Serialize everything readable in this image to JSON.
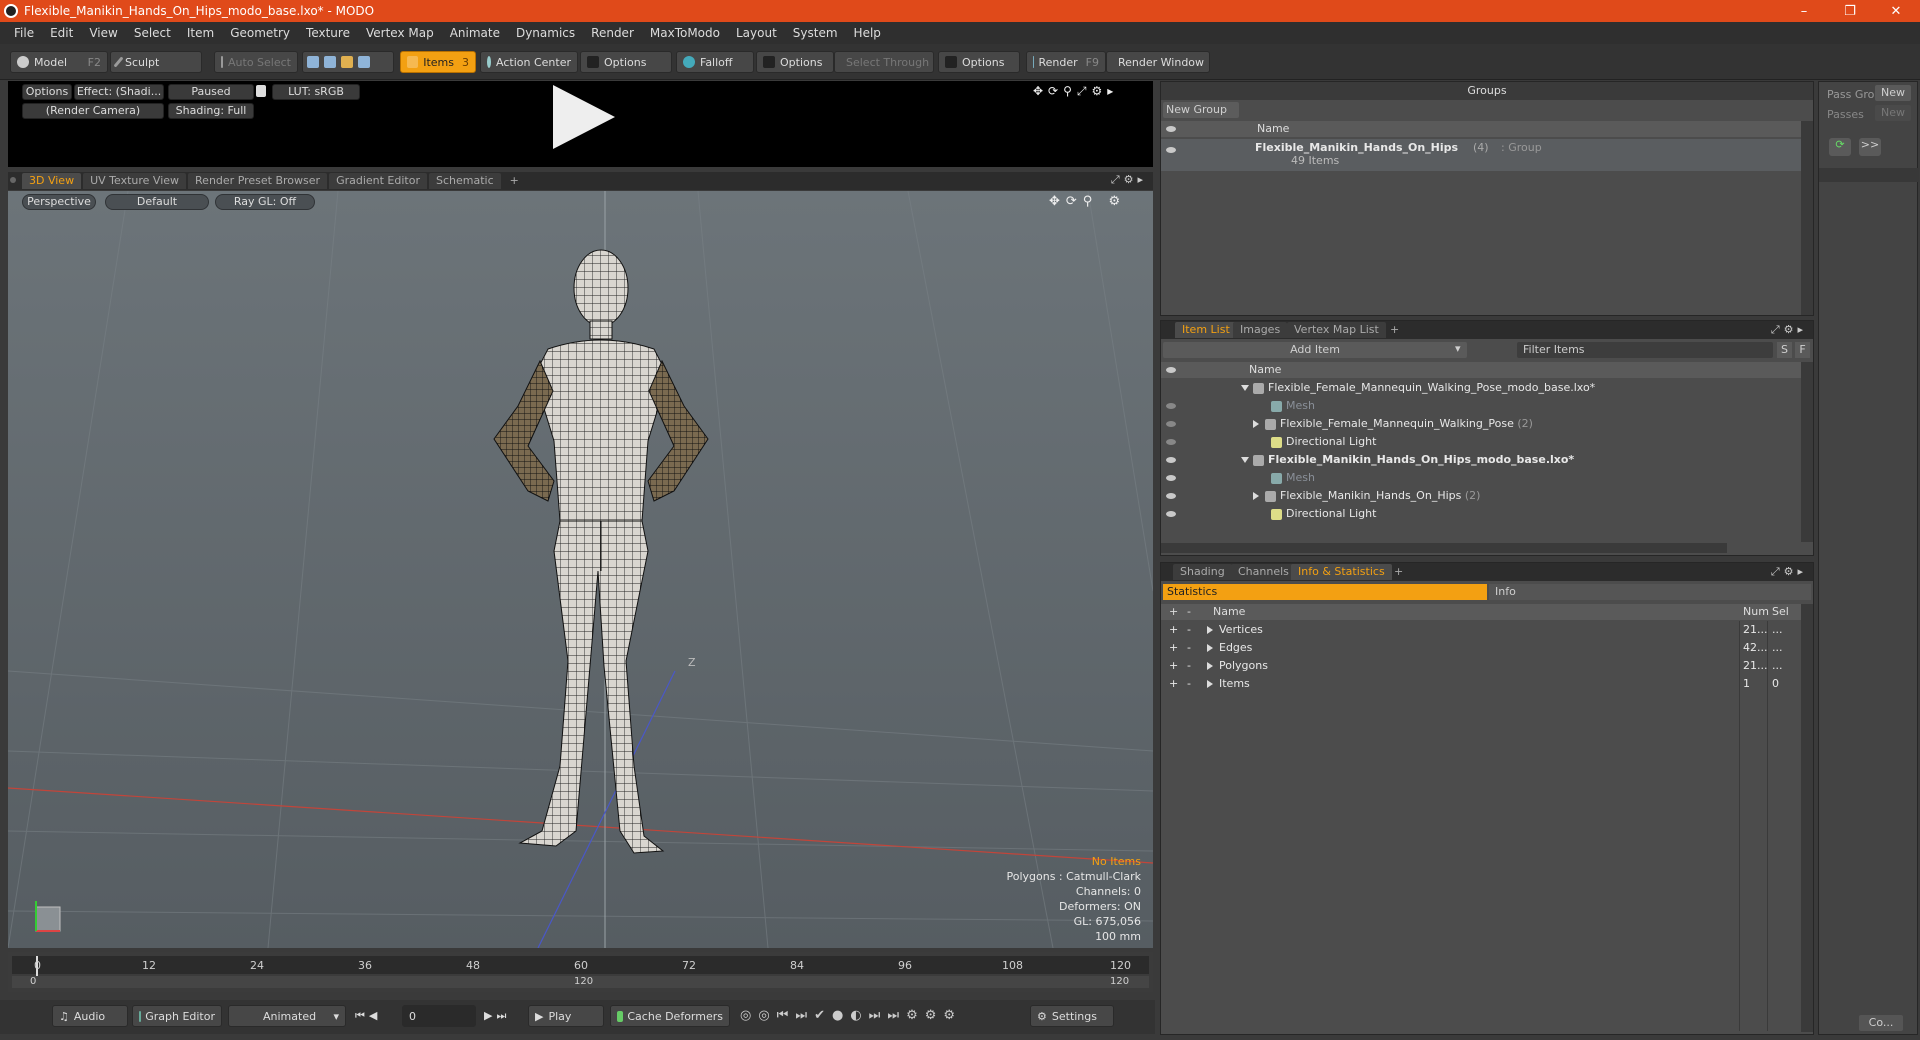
{
  "window": {
    "title": "Flexible_Manikin_Hands_On_Hips_modo_base.lxo* - MODO",
    "min": "–",
    "max": "❐",
    "close": "✕"
  },
  "menu": [
    "File",
    "Edit",
    "View",
    "Select",
    "Item",
    "Geometry",
    "Texture",
    "Vertex Map",
    "Animate",
    "Dynamics",
    "Render",
    "MaxToModo",
    "Layout",
    "System",
    "Help"
  ],
  "toolbar": {
    "model": "Model",
    "model_key": "F2",
    "sculpt": "Sculpt",
    "auto_select": "Auto Select",
    "items": "Items",
    "items_key": "3",
    "action_center": "Action Center",
    "options1": "Options",
    "falloff": "Falloff",
    "options2": "Options",
    "select_through": "Select Through",
    "options3": "Options",
    "render": "Render",
    "render_key": "F9",
    "render_window": "Render Window"
  },
  "preview": {
    "options": "Options",
    "effect": "Effect: (Shadi...",
    "paused": "Paused",
    "lut": "LUT: sRGB",
    "camera": "(Render Camera)",
    "shading": "Shading: Full"
  },
  "viewtabs": [
    "3D View",
    "UV Texture View",
    "Render Preset Browser",
    "Gradient Editor",
    "Schematic",
    "+"
  ],
  "viewport": {
    "perspective": "Perspective",
    "default": "Default",
    "raygl": "Ray GL: Off",
    "axis_z": "Z"
  },
  "stats": {
    "no_items": "No Items",
    "polygons": "Polygons : Catmull-Clark",
    "channels": "Channels: 0",
    "deformers": "Deformers: ON",
    "gl": "GL: 675,056",
    "size": "100 mm"
  },
  "timeline": {
    "ticks": [
      "0",
      "12",
      "24",
      "36",
      "48",
      "60",
      "72",
      "84",
      "96",
      "108",
      "120"
    ],
    "start": "0",
    "mid": "120",
    "end": "120"
  },
  "bottom": {
    "audio": "Audio",
    "graph_editor": "Graph Editor",
    "animated": "Animated",
    "frame": "0",
    "play": "Play",
    "cache_deformers": "Cache Deformers",
    "settings": "Settings"
  },
  "groups": {
    "title": "Groups",
    "new_group": "New Group",
    "col_name": "Name",
    "group_name": "Flexible_Manikin_Hands_On_Hips",
    "group_count": "(4)",
    "group_type": ": Group",
    "group_items": "49 Items"
  },
  "side": {
    "pass_group": "Pass Gro",
    "new1": "New",
    "passes": "Passes",
    "new2": "New",
    "more": ">>",
    "co": "Co..."
  },
  "itemlist": {
    "tabs": [
      "Item List",
      "Images",
      "Vertex Map List",
      "+"
    ],
    "add_item": "Add Item",
    "filter": "Filter Items",
    "s": "S",
    "f": "F",
    "col_name": "Name",
    "rows": [
      {
        "label": "Flexible_Female_Mannequin_Walking_Pose_modo_base.lxo*",
        "level": 0,
        "kind": "scene",
        "dim": false
      },
      {
        "label": "Mesh",
        "level": 1,
        "kind": "mesh",
        "dim": true
      },
      {
        "label": "Flexible_Female_Mannequin_Walking_Pose",
        "count": "(2)",
        "level": 1,
        "kind": "group",
        "dim": false
      },
      {
        "label": "Directional Light",
        "level": 1,
        "kind": "light",
        "dim": false
      },
      {
        "label": "Flexible_Manikin_Hands_On_Hips_modo_base.lxo*",
        "level": 0,
        "kind": "scene",
        "dim": false,
        "bold": true
      },
      {
        "label": "Mesh",
        "level": 1,
        "kind": "mesh",
        "dim": true
      },
      {
        "label": "Flexible_Manikin_Hands_On_Hips",
        "count": "(2)",
        "level": 1,
        "kind": "group",
        "dim": false
      },
      {
        "label": "Directional Light",
        "level": 1,
        "kind": "light",
        "dim": false
      }
    ]
  },
  "info": {
    "tabs": [
      "Shading",
      "Channels",
      "Info & Statistics",
      "+"
    ],
    "statistics": "Statistics",
    "info": "Info",
    "col_name": "Name",
    "col_num": "Num",
    "col_sel": "Sel",
    "rows": [
      {
        "name": "Vertices",
        "num": "21...",
        "sel": "..."
      },
      {
        "name": "Edges",
        "num": "42...",
        "sel": "..."
      },
      {
        "name": "Polygons",
        "num": "21...",
        "sel": "..."
      },
      {
        "name": "Items",
        "num": "1",
        "sel": "0"
      }
    ]
  },
  "colors": {
    "accent": "#f3a012",
    "title": "#e04a1a"
  }
}
